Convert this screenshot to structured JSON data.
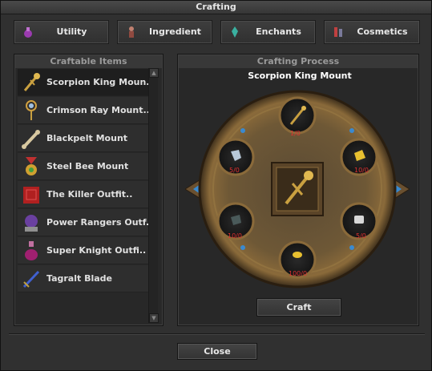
{
  "window": {
    "title": "Crafting"
  },
  "tabs": [
    {
      "label": "Utility",
      "icon": "potion-icon",
      "color": "#9b3bb0"
    },
    {
      "label": "Ingredient",
      "icon": "figure-icon",
      "color": "#b06a5a"
    },
    {
      "label": "Enchants",
      "icon": "crystal-icon",
      "color": "#3ab0a0"
    },
    {
      "label": "Cosmetics",
      "icon": "outfit-icon",
      "color": "#c04040"
    }
  ],
  "craftable": {
    "title": "Craftable Items",
    "items": [
      {
        "label": "Scorpion King Moun..",
        "icon": "scepter-icon",
        "selected": true
      },
      {
        "label": "Crimson Ray Mount..",
        "icon": "orb-staff-icon",
        "selected": false
      },
      {
        "label": "Blackpelt Mount",
        "icon": "bone-icon",
        "selected": false
      },
      {
        "label": "Steel Bee Mount",
        "icon": "medal-icon",
        "selected": false
      },
      {
        "label": "The Killer Outfit..",
        "icon": "red-book-icon",
        "selected": false
      },
      {
        "label": "Power Rangers Outf..",
        "icon": "orb-pedestal-icon",
        "selected": false
      },
      {
        "label": "Super Knight Outfi..",
        "icon": "flask-icon",
        "selected": false
      },
      {
        "label": "Tagralt Blade",
        "icon": "sword-icon",
        "selected": false
      }
    ]
  },
  "process": {
    "title": "Crafting Process",
    "selected_name": "Scorpion King Mount",
    "result_icon": "scepter-icon",
    "slots": [
      {
        "pos": "top",
        "count": "1/0",
        "icon": "scepter-icon"
      },
      {
        "pos": "upper-left",
        "count": "5/0",
        "icon": "silver-ore-icon"
      },
      {
        "pos": "upper-right",
        "count": "10/0",
        "icon": "gold-nugget-icon"
      },
      {
        "pos": "lower-left",
        "count": "10/0",
        "icon": "dark-ore-icon"
      },
      {
        "pos": "lower-right",
        "count": "5/0",
        "icon": "gauntlet-icon"
      },
      {
        "pos": "bottom",
        "count": "100/0",
        "icon": "gold-coin-icon"
      }
    ],
    "craft_label": "Craft"
  },
  "footer": {
    "close_label": "Close"
  },
  "colors": {
    "count_red": "#e03030",
    "bronze": "#8a6a3a",
    "accent_blue": "#3a8ad0"
  }
}
